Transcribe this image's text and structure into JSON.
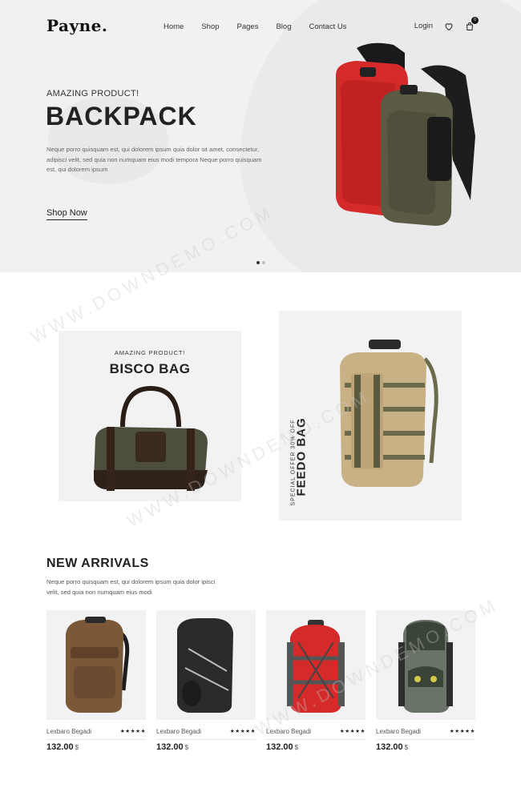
{
  "header": {
    "logo": "Payne.",
    "nav": [
      "Home",
      "Shop",
      "Pages",
      "Blog",
      "Contact Us"
    ],
    "login": "Login",
    "cart_count": "0"
  },
  "hero": {
    "eyebrow": "AMAZING PRODUCT!",
    "title": "BACKPACK",
    "description": "Neque porro quisquam est, qui dolorem ipsum quia dolor sit amet, consectetur, adipisci velit, sed quia non numquam eius modi tempora Neque porro quisquam est, qui dolorem ipsum",
    "cta": "Shop Now",
    "slide_count": 2,
    "active_slide": 1
  },
  "promo": {
    "left": {
      "eyebrow": "AMAZING PRODUCT!",
      "title": "BISCO BAG"
    },
    "right": {
      "offer": "SPECIAL OFFER 30% OFF",
      "title": "FEEDO BAG"
    }
  },
  "new_arrivals": {
    "title": "NEW ARRIVALS",
    "description": "Neque porro quisquam est, qui dolorem ipsum quia dolor ipisci velit, sed quia non numquam eius modi",
    "products": [
      {
        "name": "Lexbaro Begadi",
        "price": "132.00",
        "currency": "$",
        "rating": 5,
        "stars": "★★★★★"
      },
      {
        "name": "Lexbaro Begadi",
        "price": "132.00",
        "currency": "$",
        "rating": 5,
        "stars": "★★★★★"
      },
      {
        "name": "Lexbaro Begadi",
        "price": "132.00",
        "currency": "$",
        "rating": 5,
        "stars": "★★★★★"
      },
      {
        "name": "Lexbaro Begadi",
        "price": "132.00",
        "currency": "$",
        "rating": 5,
        "stars": "★★★★★"
      }
    ]
  },
  "watermark": "WWW.DOWNDEMO.COM",
  "colors": {
    "hero_bg": "#f1f1f2",
    "card_bg": "#f2f2f3",
    "text": "#222222",
    "accent_red": "#d42a2a",
    "olive": "#5a5a45"
  }
}
